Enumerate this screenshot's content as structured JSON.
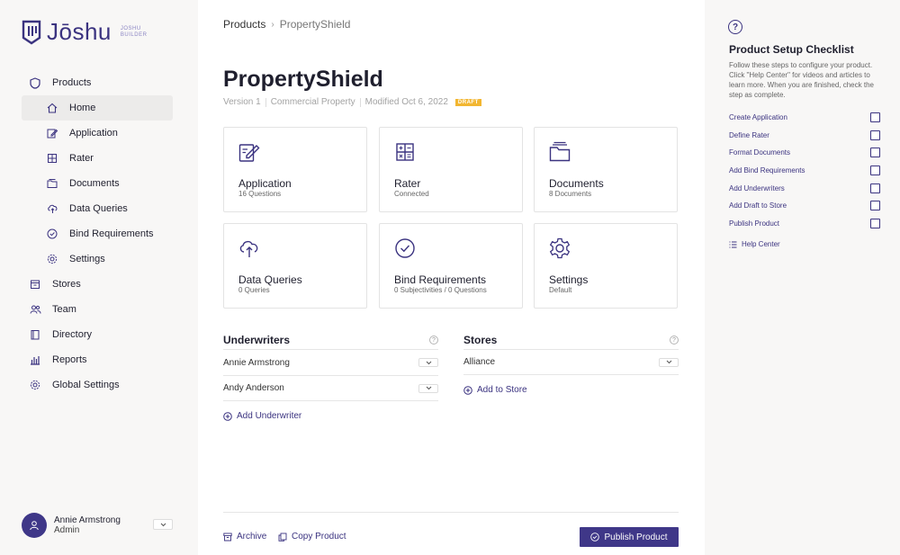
{
  "brand": {
    "name": "Jōshu",
    "sub_line1": "JOSHU",
    "sub_line2": "BUILDER",
    "color": "#3b3380"
  },
  "sidebar": {
    "items": [
      {
        "label": "Products",
        "icon": "shield-icon",
        "level": "top"
      },
      {
        "label": "Home",
        "icon": "home-icon",
        "level": "sub",
        "active": true
      },
      {
        "label": "Application",
        "icon": "edit-icon",
        "level": "sub"
      },
      {
        "label": "Rater",
        "icon": "calculator-icon",
        "level": "sub"
      },
      {
        "label": "Documents",
        "icon": "folder-icon",
        "level": "sub"
      },
      {
        "label": "Data Queries",
        "icon": "cloud-upload-icon",
        "level": "sub"
      },
      {
        "label": "Bind Requirements",
        "icon": "check-circle-icon",
        "level": "sub"
      },
      {
        "label": "Settings",
        "icon": "gear-icon",
        "level": "sub"
      },
      {
        "label": "Stores",
        "icon": "store-icon",
        "level": "top"
      },
      {
        "label": "Team",
        "icon": "team-icon",
        "level": "top"
      },
      {
        "label": "Directory",
        "icon": "book-icon",
        "level": "top"
      },
      {
        "label": "Reports",
        "icon": "bar-chart-icon",
        "level": "top"
      },
      {
        "label": "Global Settings",
        "icon": "gear-icon",
        "level": "top"
      }
    ],
    "user": {
      "name": "Annie Armstrong",
      "role": "Admin"
    }
  },
  "main": {
    "breadcrumb": {
      "root": "Products",
      "current": "PropertyShield"
    },
    "title": "PropertyShield",
    "meta": {
      "version": "Version 1",
      "type": "Commercial Property",
      "modified": "Modified Oct 6, 2022",
      "status": "DRAFT"
    },
    "cards": [
      {
        "title": "Application",
        "sub": "16 Questions",
        "icon": "edit-icon"
      },
      {
        "title": "Rater",
        "sub": "Connected",
        "icon": "calculator-icon"
      },
      {
        "title": "Documents",
        "sub": "8 Documents",
        "icon": "folder-icon"
      },
      {
        "title": "Data Queries",
        "sub": "0 Queries",
        "icon": "cloud-upload-icon"
      },
      {
        "title": "Bind Requirements",
        "sub": "0 Subjectivities / 0 Questions",
        "icon": "check-circle-icon"
      },
      {
        "title": "Settings",
        "sub": "Default",
        "icon": "gear-icon"
      }
    ],
    "underwriters": {
      "heading": "Underwriters",
      "rows": [
        "Annie Armstrong",
        "Andy Anderson"
      ],
      "add_label": "Add Underwriter"
    },
    "stores": {
      "heading": "Stores",
      "rows": [
        "Alliance"
      ],
      "add_label": "Add to Store"
    },
    "footer": {
      "archive": "Archive",
      "copy": "Copy Product",
      "publish": "Publish Product"
    }
  },
  "checklist": {
    "title": "Product Setup Checklist",
    "description": "Follow these steps to configure your product. Click \"Help Center\" for videos and articles to learn more. When you are finished, check the step as complete.",
    "items": [
      "Create Application",
      "Define Rater",
      "Format Documents",
      "Add Bind Requirements",
      "Add Underwriters",
      "Add Draft to Store",
      "Publish Product"
    ],
    "help_label": "Help Center"
  }
}
